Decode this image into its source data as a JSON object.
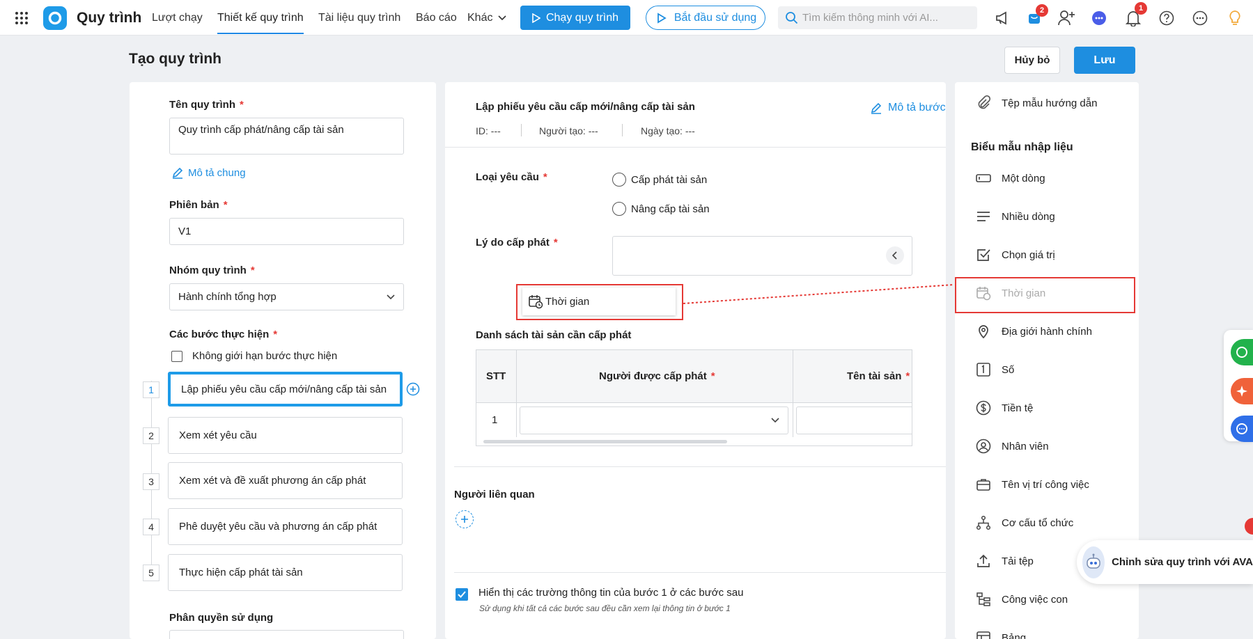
{
  "topbar": {
    "app_title": "Quy trình",
    "tabs": [
      "Lượt chạy",
      "Thiết kế quy trình",
      "Tài liệu quy trình",
      "Báo cáo",
      "Khác"
    ],
    "run_button": "Chạy quy trình",
    "start_button": "Bắt đầu sử dụng",
    "search_placeholder": "Tìm kiếm thông minh với AI...",
    "cart_badge": "2",
    "notif_badge": "1"
  },
  "page": {
    "title": "Tạo quy trình",
    "cancel_label": "Hủy bỏ",
    "save_label": "Lưu"
  },
  "left": {
    "name_label": "Tên quy trình",
    "name_value": "Quy trình cấp phát/nâng cấp tài sản",
    "desc_link": "Mô tả chung",
    "version_label": "Phiên bản",
    "version_value": "V1",
    "group_label": "Nhóm quy trình",
    "group_value": "Hành chính tổng hợp",
    "steps_label": "Các bước thực hiện",
    "unlimited_label": "Không giới hạn bước thực hiện",
    "steps": [
      {
        "num": "1",
        "label": "Lập phiếu yêu cầu cấp mới/nâng cấp tài sản"
      },
      {
        "num": "2",
        "label": "Xem xét yêu cầu"
      },
      {
        "num": "3",
        "label": "Xem xét và đề xuất phương án cấp phát"
      },
      {
        "num": "4",
        "label": "Phê duyệt yêu cầu và phương án cấp phát"
      },
      {
        "num": "5",
        "label": "Thực hiện cấp phát tài sản"
      }
    ],
    "permission_label": "Phân quyền sử dụng"
  },
  "middle": {
    "step_title": "Lập phiếu yêu cầu cấp mới/nâng cấp tài sản",
    "edit_step_link": "Mô tả bước",
    "id_text": "ID: ---",
    "creator_text": "Người tạo: ---",
    "created_text": "Ngày tạo: ---",
    "request_type_label": "Loại yêu cầu",
    "options": [
      "Cấp phát tài sản",
      "Nâng cấp tài sản"
    ],
    "reason_label": "Lý do cấp phát",
    "drag_item": "Thời gian",
    "asset_list_label": "Danh sách tài sản cần cấp phát",
    "table_headers": [
      "STT",
      "Người được cấp phát",
      "Tên tài sản"
    ],
    "table_row_num": "1",
    "related_label": "Người liên quan",
    "show_fields_label": "Hiển thị các trường thông tin của bước 1 ở các bước sau",
    "show_fields_hint": "Sử dụng khi tất cả các bước sau đều cần xem lại thông tin ở bước 1"
  },
  "right": {
    "template_link": "Tệp mẫu hướng dẫn",
    "section_title": "Biểu mẫu nhập liệu",
    "fields": [
      "Một dòng",
      "Nhiều dòng",
      "Chọn giá trị",
      "Thời gian",
      "Địa giới hành chính",
      "Số",
      "Tiền tệ",
      "Nhân viên",
      "Tên vị trí công việc",
      "Cơ cấu tổ chức",
      "Tải tệp",
      "Công việc con",
      "Bảng"
    ]
  },
  "ava_button": "Chỉnh sửa quy trình với AVA",
  "colors": {
    "accent": "#1e8ee0",
    "danger": "#e53935"
  }
}
